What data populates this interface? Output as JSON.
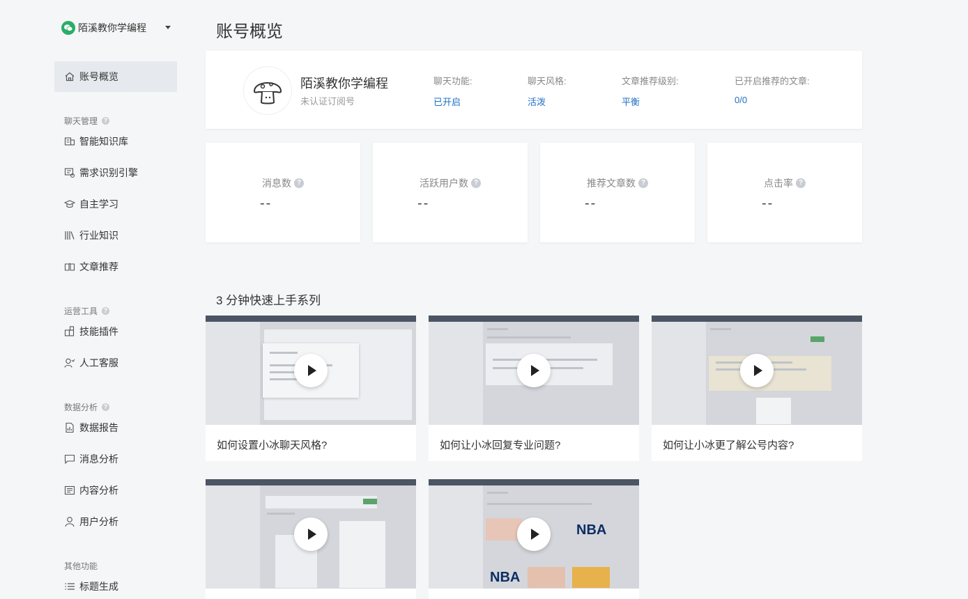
{
  "account": {
    "name": "陌溪教你学编程",
    "subtitle": "未认证订阅号"
  },
  "sidebar": {
    "active": {
      "label": "账号概览",
      "icon": "home-icon"
    },
    "sections": [
      {
        "title": "聊天管理",
        "items": [
          {
            "label": "智能知识库",
            "icon": "knowledge-icon"
          },
          {
            "label": "需求识别引擎",
            "icon": "engine-icon"
          },
          {
            "label": "自主学习",
            "icon": "graduation-icon"
          },
          {
            "label": "行业知识",
            "icon": "books-icon"
          },
          {
            "label": "文章推荐",
            "icon": "open-book-icon"
          }
        ]
      },
      {
        "title": "运营工具",
        "items": [
          {
            "label": "技能插件",
            "icon": "plugin-icon"
          },
          {
            "label": "人工客服",
            "icon": "agent-icon"
          }
        ]
      },
      {
        "title": "数据分析",
        "items": [
          {
            "label": "数据报告",
            "icon": "report-icon"
          },
          {
            "label": "消息分析",
            "icon": "message-icon"
          },
          {
            "label": "内容分析",
            "icon": "content-icon"
          },
          {
            "label": "用户分析",
            "icon": "user-icon"
          }
        ]
      },
      {
        "title": "其他功能",
        "items": [
          {
            "label": "标题生成",
            "icon": "list-icon"
          }
        ]
      }
    ]
  },
  "main": {
    "page_title": "账号概览",
    "profile_fields": [
      {
        "label": "聊天功能:",
        "value": "已开启"
      },
      {
        "label": "聊天风格:",
        "value": "活泼"
      },
      {
        "label": "文章推荐级别:",
        "value": "平衡"
      },
      {
        "label": "已开启推荐的文章:",
        "value": "0/0"
      }
    ],
    "stats": [
      {
        "label": "消息数",
        "value": "--"
      },
      {
        "label": "活跃用户数",
        "value": "--"
      },
      {
        "label": "推荐文章数",
        "value": "--"
      },
      {
        "label": "点击率",
        "value": "--"
      }
    ],
    "tutorial_title": "3 分钟快速上手系列",
    "videos": [
      {
        "title": "如何设置小冰聊天风格?"
      },
      {
        "title": "如何让小冰回复专业问题?"
      },
      {
        "title": "如何让小冰更了解公号内容?"
      },
      {
        "title": ""
      },
      {
        "title": ""
      }
    ],
    "thumb_text": {
      "nba": "NBA"
    }
  },
  "colors": {
    "accent": "#1f6fc5",
    "wechat_green": "#2aae67",
    "active_bg": "#e6e9ee"
  }
}
